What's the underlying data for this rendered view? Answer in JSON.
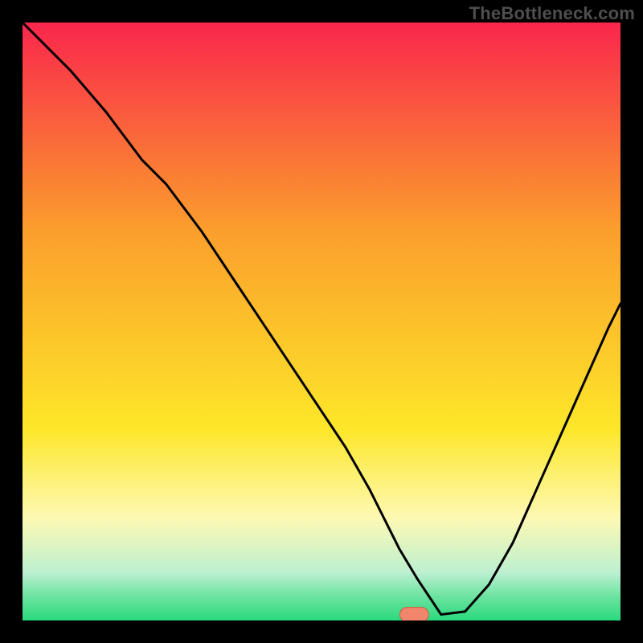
{
  "watermark": "TheBottleneck.com",
  "colors": {
    "top": "#f9264c",
    "upper_mid": "#fb9f2c",
    "mid": "#fde729",
    "pale": "#fdf9b4",
    "green": "#2bd97e",
    "green_mid": "#6be39f",
    "green_pale": "#bcf0d1",
    "curve": "#000000",
    "marker_fill": "#f1866a",
    "marker_stroke": "#d35a42",
    "bg": "#000000"
  },
  "chart_data": {
    "type": "line",
    "title": "",
    "xlabel": "",
    "ylabel": "",
    "xlim": [
      0,
      100
    ],
    "ylim": [
      0,
      100
    ],
    "series": [
      {
        "name": "bottleneck-curve",
        "x": [
          0,
          3,
          8,
          14,
          20,
          24,
          30,
          36,
          42,
          48,
          54,
          58,
          61,
          63,
          66,
          68,
          70,
          74,
          78,
          82,
          86,
          90,
          94,
          98,
          100
        ],
        "y": [
          100,
          97,
          92,
          85,
          77,
          73,
          65,
          56,
          47,
          38,
          29,
          22,
          16,
          12,
          7,
          4,
          1,
          1.5,
          6,
          13,
          22,
          31,
          40,
          49,
          53
        ]
      }
    ],
    "marker": {
      "x": 65.5,
      "y": 1.0,
      "rx": 2.4,
      "ry": 1.2
    },
    "gradient_stops": [
      {
        "offset": 0.0,
        "color_key": "top"
      },
      {
        "offset": 0.35,
        "color_key": "upper_mid"
      },
      {
        "offset": 0.68,
        "color_key": "mid"
      },
      {
        "offset": 0.83,
        "color_key": "pale"
      },
      {
        "offset": 0.92,
        "color_key": "green_pale"
      },
      {
        "offset": 0.96,
        "color_key": "green_mid"
      },
      {
        "offset": 1.0,
        "color_key": "green"
      }
    ]
  }
}
